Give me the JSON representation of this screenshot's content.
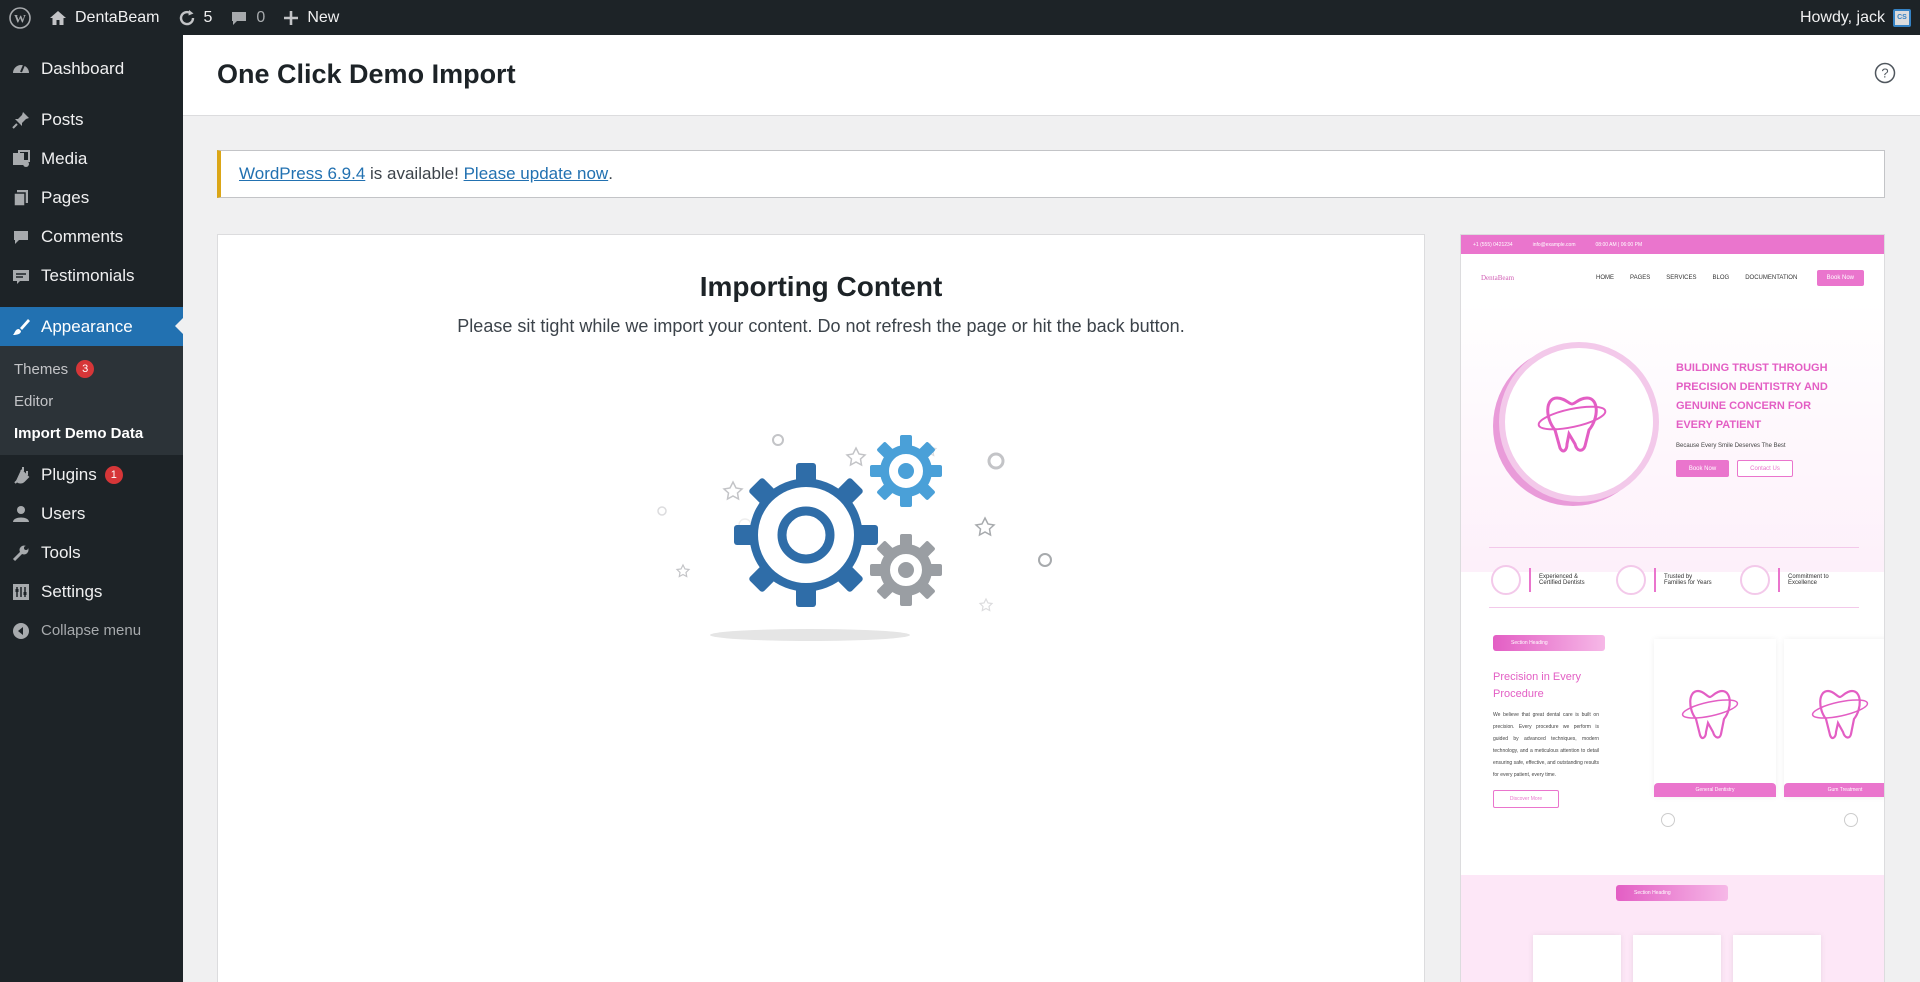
{
  "adminbar": {
    "site_name": "DentaBeam",
    "updates_count": "5",
    "comments_count": "0",
    "new_label": "New",
    "howdy": "Howdy, jack",
    "avatar_text": "CS"
  },
  "sidebar": {
    "items": [
      {
        "label": "Dashboard",
        "icon": "dashboard-icon"
      },
      {
        "label": "Posts",
        "icon": "pin-icon"
      },
      {
        "label": "Media",
        "icon": "media-icon"
      },
      {
        "label": "Pages",
        "icon": "pages-icon"
      },
      {
        "label": "Comments",
        "icon": "comment-icon"
      },
      {
        "label": "Testimonials",
        "icon": "testimonial-icon"
      },
      {
        "label": "Appearance",
        "icon": "brush-icon"
      },
      {
        "label": "Plugins",
        "icon": "plug-icon",
        "badge": "1"
      },
      {
        "label": "Users",
        "icon": "user-icon"
      },
      {
        "label": "Tools",
        "icon": "wrench-icon"
      },
      {
        "label": "Settings",
        "icon": "settings-icon"
      },
      {
        "label": "Collapse menu",
        "icon": "collapse-icon"
      }
    ],
    "submenu": [
      {
        "label": "Themes",
        "badge": "3"
      },
      {
        "label": "Editor"
      },
      {
        "label": "Import Demo Data"
      }
    ]
  },
  "header": {
    "title": "One Click Demo Import"
  },
  "notice": {
    "link1": "WordPress 6.9.4",
    "middle": " is available! ",
    "link2": "Please update now",
    "end": "."
  },
  "import": {
    "title": "Importing Content",
    "description": "Please sit tight while we import your content. Do not refresh the page or hit the back button."
  },
  "preview": {
    "topbar": [
      "+1 (555) 0421234",
      "info@example.com",
      "08:00 AM | 06:00 PM"
    ],
    "logo": "DentaBeam",
    "nav": [
      "HOME",
      "PAGES",
      "SERVICES",
      "BLOG",
      "DOCUMENTATION"
    ],
    "book_now": "Book Now",
    "hero_title": "BUILDING TRUST THROUGH PRECISION DENTISTRY AND GENUINE CONCERN FOR EVERY PATIENT",
    "hero_sub": "Because Every Smile Deserves The Best",
    "hero_btn1": "Book Now",
    "hero_btn2": "Contact Us",
    "features": [
      "Experienced & Certified Dentists",
      "Trusted by Families for Years",
      "Commitment to Excellence"
    ],
    "section_tag": "Section Heading",
    "proc_title": "Precision in Every Procedure",
    "proc_text": "We believe that great dental care is built on precision. Every procedure we perform is guided by advanced techniques, modern technology, and a meticulous attention to detail ensuring safe, effective, and outstanding results for every patient, every time.",
    "discover": "Discover More",
    "card1": "General Dentistry",
    "card2": "Gum Treatment"
  },
  "colors": {
    "admin_dark": "#1d2327",
    "accent": "#2271b1",
    "notice_warn": "#dba617",
    "badge": "#d63638",
    "theme_pink": "#ea75cd"
  }
}
